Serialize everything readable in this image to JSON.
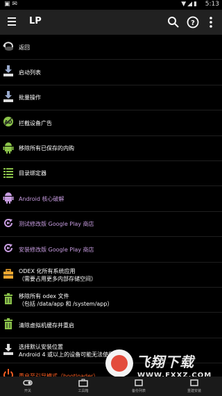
{
  "status_bar": {
    "time": "5:13"
  },
  "app_bar": {
    "title": "LP"
  },
  "items": [
    {
      "label": "返回",
      "color": "white",
      "icon": "back-icon"
    },
    {
      "label": "启动列表",
      "color": "white",
      "icon": "download-list-icon"
    },
    {
      "label": "批量操作",
      "color": "white",
      "icon": "batch-download-icon"
    },
    {
      "label": "拦截设备广告",
      "color": "white",
      "icon": "ad-block-icon"
    },
    {
      "label": "移除所有已保存的内购",
      "color": "white",
      "icon": "android-robot-icon"
    },
    {
      "label": "目录绑定器",
      "color": "white",
      "icon": "directory-binder-icon"
    },
    {
      "label": "Android 核心破解",
      "color": "purple",
      "icon": "android-core-icon"
    },
    {
      "label": "测试修改版 Google Play 商店",
      "color": "purple",
      "icon": "refresh-play-icon"
    },
    {
      "label": "安装修改版 Google Play 商店",
      "color": "purple",
      "icon": "install-play-icon"
    },
    {
      "label": "ODEX 化所有系统应用",
      "label2": "（需要占用更多内部存储空间）",
      "color": "white",
      "icon": "toolbox-icon"
    },
    {
      "label": "移除所有 odex 文件",
      "label2": "（包括 /data/app 和 /system/app）",
      "color": "white",
      "icon": "trash-icon"
    },
    {
      "label": "清除虚拟机缓存并重启",
      "color": "white",
      "icon": "trash-clear-icon"
    },
    {
      "label": "选择默认安装位置",
      "label2": "Android 4 或以上的设备可能无法使用",
      "color": "white",
      "icon": "install-location-icon"
    },
    {
      "label": "重启至引导模式（bootloader）",
      "color": "orange",
      "icon": "power-icon"
    }
  ],
  "bottom_nav": [
    {
      "label": "开关",
      "icon": "toggle-icon"
    },
    {
      "label": "工具箱",
      "icon": "toolbox-nav-icon"
    },
    {
      "label": "备份列表",
      "icon": "backup-list-icon"
    },
    {
      "label": "重建安装",
      "icon": "rebuild-install-icon"
    }
  ],
  "watermark": {
    "text": "飞翔下载",
    "url": "WWW.FXXZ.COM"
  },
  "colors": {
    "accent_green": "#8bc34a",
    "purple_text": "#c79ce0",
    "orange_text": "#ff5f22",
    "app_bar": "#212121"
  }
}
